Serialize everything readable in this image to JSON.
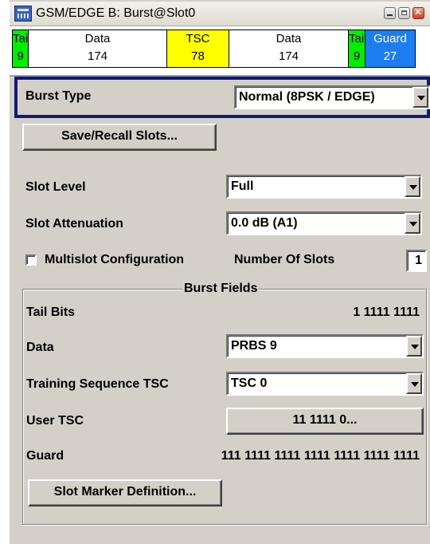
{
  "window": {
    "title": "GSM/EDGE B: Burst@Slot0"
  },
  "burst_strip": [
    {
      "name": "Tail",
      "bits": "9"
    },
    {
      "name": "Data",
      "bits": "174"
    },
    {
      "name": "TSC",
      "bits": "78"
    },
    {
      "name": "Data",
      "bits": "174"
    },
    {
      "name": "Tail",
      "bits": "9"
    },
    {
      "name": "Guard",
      "bits": "27"
    }
  ],
  "burst_type": {
    "label": "Burst Type",
    "value": "Normal (8PSK / EDGE)"
  },
  "save_recall": {
    "label": "Save/Recall Slots..."
  },
  "slot_level": {
    "label": "Slot Level",
    "value": "Full"
  },
  "slot_attenuation": {
    "label": "Slot Attenuation",
    "value": "0.0 dB  (A1)"
  },
  "multislot": {
    "label": "Multislot Configuration",
    "checked": false
  },
  "number_of_slots": {
    "label": "Number Of Slots",
    "value": "1"
  },
  "burst_fields": {
    "title": "Burst Fields",
    "tail_bits": {
      "label": "Tail Bits",
      "value": "1 1111 1111"
    },
    "data": {
      "label": "Data",
      "value": "PRBS  9"
    },
    "training_sequence": {
      "label": "Training Sequence TSC",
      "value": "TSC 0"
    },
    "user_tsc": {
      "label": "User TSC",
      "value": "11 1111 0..."
    },
    "guard": {
      "label": "Guard",
      "value": "111 1111 1111 1111 1111 1111 1111"
    },
    "slot_marker": {
      "label": "Slot Marker Definition..."
    }
  }
}
